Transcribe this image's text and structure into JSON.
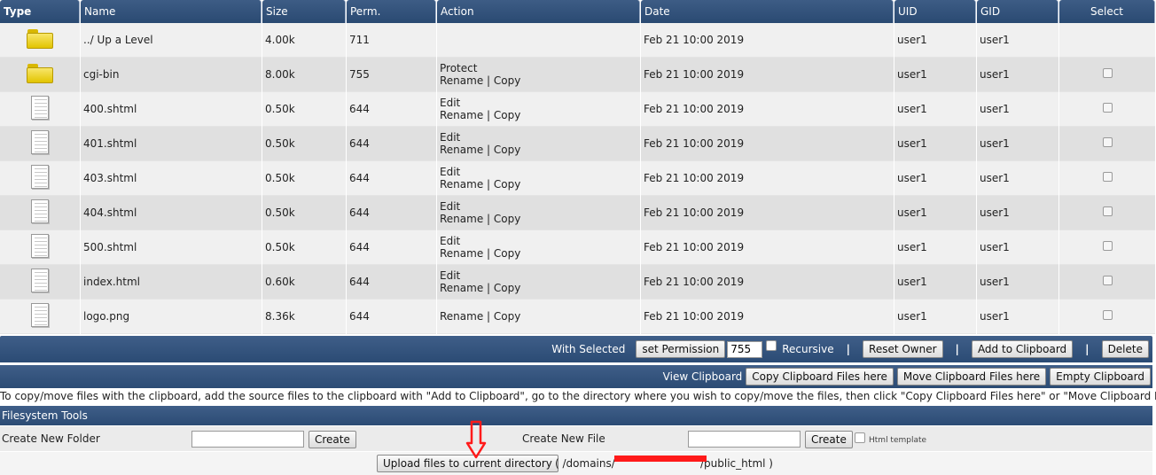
{
  "columns": {
    "type": "Type",
    "name": "Name",
    "size": "Size",
    "perm": "Perm.",
    "action": "Action",
    "date": "Date",
    "uid": "UID",
    "gid": "GID",
    "select": "Select"
  },
  "rows": [
    {
      "icon": "folder-icon",
      "name": "../ Up a Level",
      "size": "4.00k",
      "perm": "711",
      "action1": "",
      "action2": "",
      "date": "Feb 21 10:00 2019",
      "uid": "user1",
      "gid": "user1",
      "selectable": false
    },
    {
      "icon": "folder-icon",
      "name": "cgi-bin",
      "size": "8.00k",
      "perm": "755",
      "action1": "Protect",
      "action2": "Rename | Copy",
      "date": "Feb 21 10:00 2019",
      "uid": "user1",
      "gid": "user1",
      "selectable": true
    },
    {
      "icon": "file-icon",
      "name": "400.shtml",
      "size": "0.50k",
      "perm": "644",
      "action1": "Edit",
      "action2": "Rename | Copy",
      "date": "Feb 21 10:00 2019",
      "uid": "user1",
      "gid": "user1",
      "selectable": true
    },
    {
      "icon": "file-icon",
      "name": "401.shtml",
      "size": "0.50k",
      "perm": "644",
      "action1": "Edit",
      "action2": "Rename | Copy",
      "date": "Feb 21 10:00 2019",
      "uid": "user1",
      "gid": "user1",
      "selectable": true
    },
    {
      "icon": "file-icon",
      "name": "403.shtml",
      "size": "0.50k",
      "perm": "644",
      "action1": "Edit",
      "action2": "Rename | Copy",
      "date": "Feb 21 10:00 2019",
      "uid": "user1",
      "gid": "user1",
      "selectable": true
    },
    {
      "icon": "file-icon",
      "name": "404.shtml",
      "size": "0.50k",
      "perm": "644",
      "action1": "Edit",
      "action2": "Rename | Copy",
      "date": "Feb 21 10:00 2019",
      "uid": "user1",
      "gid": "user1",
      "selectable": true
    },
    {
      "icon": "file-icon",
      "name": "500.shtml",
      "size": "0.50k",
      "perm": "644",
      "action1": "Edit",
      "action2": "Rename | Copy",
      "date": "Feb 21 10:00 2019",
      "uid": "user1",
      "gid": "user1",
      "selectable": true
    },
    {
      "icon": "file-icon",
      "name": "index.html",
      "size": "0.60k",
      "perm": "644",
      "action1": "Edit",
      "action2": "Rename | Copy",
      "date": "Feb 21 10:00 2019",
      "uid": "user1",
      "gid": "user1",
      "selectable": true
    },
    {
      "icon": "file-icon",
      "name": "logo.png",
      "size": "8.36k",
      "perm": "644",
      "action1": "",
      "action2": "Rename | Copy",
      "date": "Feb 21 10:00 2019",
      "uid": "user1",
      "gid": "user1",
      "selectable": true
    }
  ],
  "selected_bar": {
    "label": "With Selected",
    "set_permission": "set Permission",
    "permission_value": "755",
    "recursive": "Recursive",
    "reset_owner": "Reset Owner",
    "add_to_clipboard": "Add to Clipboard",
    "delete": "Delete",
    "separator": "|"
  },
  "clipboard_bar": {
    "view": "View Clipboard",
    "copy_here": "Copy Clipboard Files here",
    "move_here": "Move Clipboard Files here",
    "empty": "Empty Clipboard"
  },
  "note": "To copy/move files with the clipboard, add the source files to the clipboard with \"Add to Clipboard\", go to the directory where you wish to copy/move the files, then click \"Copy Clipboard Files here\" or \"Move Clipboard Files here\"",
  "tools": {
    "title": "Filesystem Tools",
    "create_folder_label": "Create New Folder",
    "create_folder_button": "Create",
    "create_file_label": "Create New File",
    "create_file_button": "Create",
    "html_template": "Html template",
    "upload_button": "Upload files to current directory",
    "path_prefix": "( /domains/",
    "path_suffix": "/public_html )"
  },
  "colors": {
    "header": "#2f4f7a",
    "annotation": "#ff1a1a"
  }
}
